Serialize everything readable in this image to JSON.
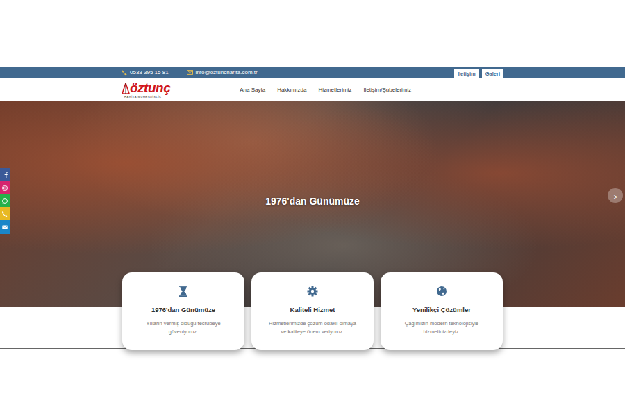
{
  "topbar": {
    "phone": "0533 395 15 81",
    "email": "info@oztuncharita.com.tr",
    "buttons": [
      "İletişim",
      "Galeri"
    ]
  },
  "logo": {
    "name": "öztunç",
    "subtitle": "HARİTA MÜHENDİSLİK"
  },
  "nav": [
    {
      "label": "Ana Sayfa"
    },
    {
      "label": "Hakkımızda"
    },
    {
      "label": "Hizmetlerimiz"
    },
    {
      "label": "İletişim/Şubelerimiz"
    }
  ],
  "hero": {
    "title": "1976'dan Günümüze",
    "next": "›"
  },
  "social": [
    {
      "kind": "facebook",
      "color": "#3b5998"
    },
    {
      "kind": "instagram",
      "color": "#d6246e"
    },
    {
      "kind": "whatsapp",
      "color": "#25b04a"
    },
    {
      "kind": "phone",
      "color": "#e8b923"
    },
    {
      "kind": "mail",
      "color": "#1a86c8"
    }
  ],
  "cards": [
    {
      "kind": "hourglass",
      "title": "1976'dan Günümüze",
      "text": "Yılların vermiş olduğu tecrübeye güveniyoruz."
    },
    {
      "kind": "gear",
      "title": "Kaliteli Hizmet",
      "text": "Hizmetlerimizde çözüm odaklı olmaya ve kaliteye önem veriyoruz."
    },
    {
      "kind": "globe",
      "title": "Yenilikçi Çözümler",
      "text": "Çağımızın modern teknolojisiyle hizmetinizdeyiz."
    }
  ]
}
